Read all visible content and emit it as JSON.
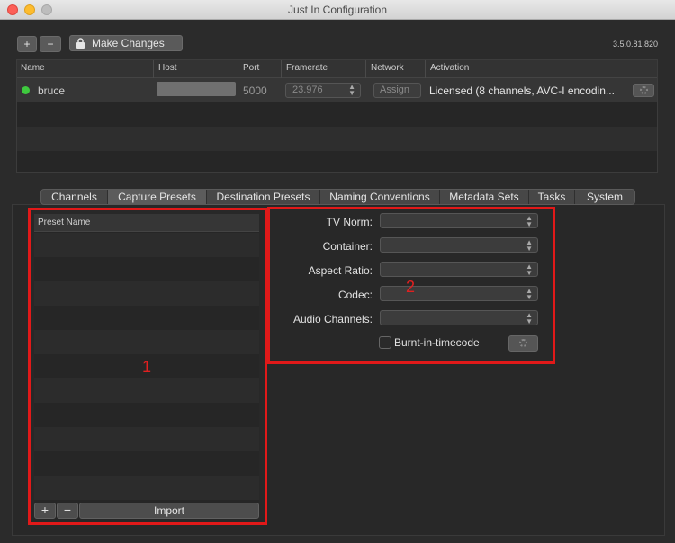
{
  "window": {
    "title": "Just In Configuration"
  },
  "toolbar": {
    "add_label": "+",
    "remove_label": "−",
    "make_changes_label": "Make Changes",
    "version": "3.5.0.81.820"
  },
  "table": {
    "columns": [
      "Name",
      "Host",
      "Port",
      "Framerate",
      "Network",
      "Activation"
    ],
    "rows": [
      {
        "status_color": "#3ec93e",
        "name": "bruce",
        "host": "",
        "port": "5000",
        "framerate": "23.976",
        "network_button": "Assign",
        "activation": "Licensed (8 channels, AVC-I encodin..."
      }
    ]
  },
  "tabs": [
    "Channels",
    "Capture Presets",
    "Destination Presets",
    "Naming Conventions",
    "Metadata Sets",
    "Tasks",
    "System"
  ],
  "active_tab": "Capture Presets",
  "preset_list": {
    "header": "Preset Name",
    "add_label": "+",
    "remove_label": "−",
    "import_label": "Import"
  },
  "form": {
    "tv_norm_label": "TV Norm:",
    "container_label": "Container:",
    "aspect_ratio_label": "Aspect Ratio:",
    "codec_label": "Codec:",
    "audio_channels_label": "Audio Channels:",
    "burnin_label": "Burnt-in-timecode",
    "burnin_checked": false
  },
  "annotations": {
    "box1": "1",
    "box2": "2",
    "color": "#e11919"
  }
}
